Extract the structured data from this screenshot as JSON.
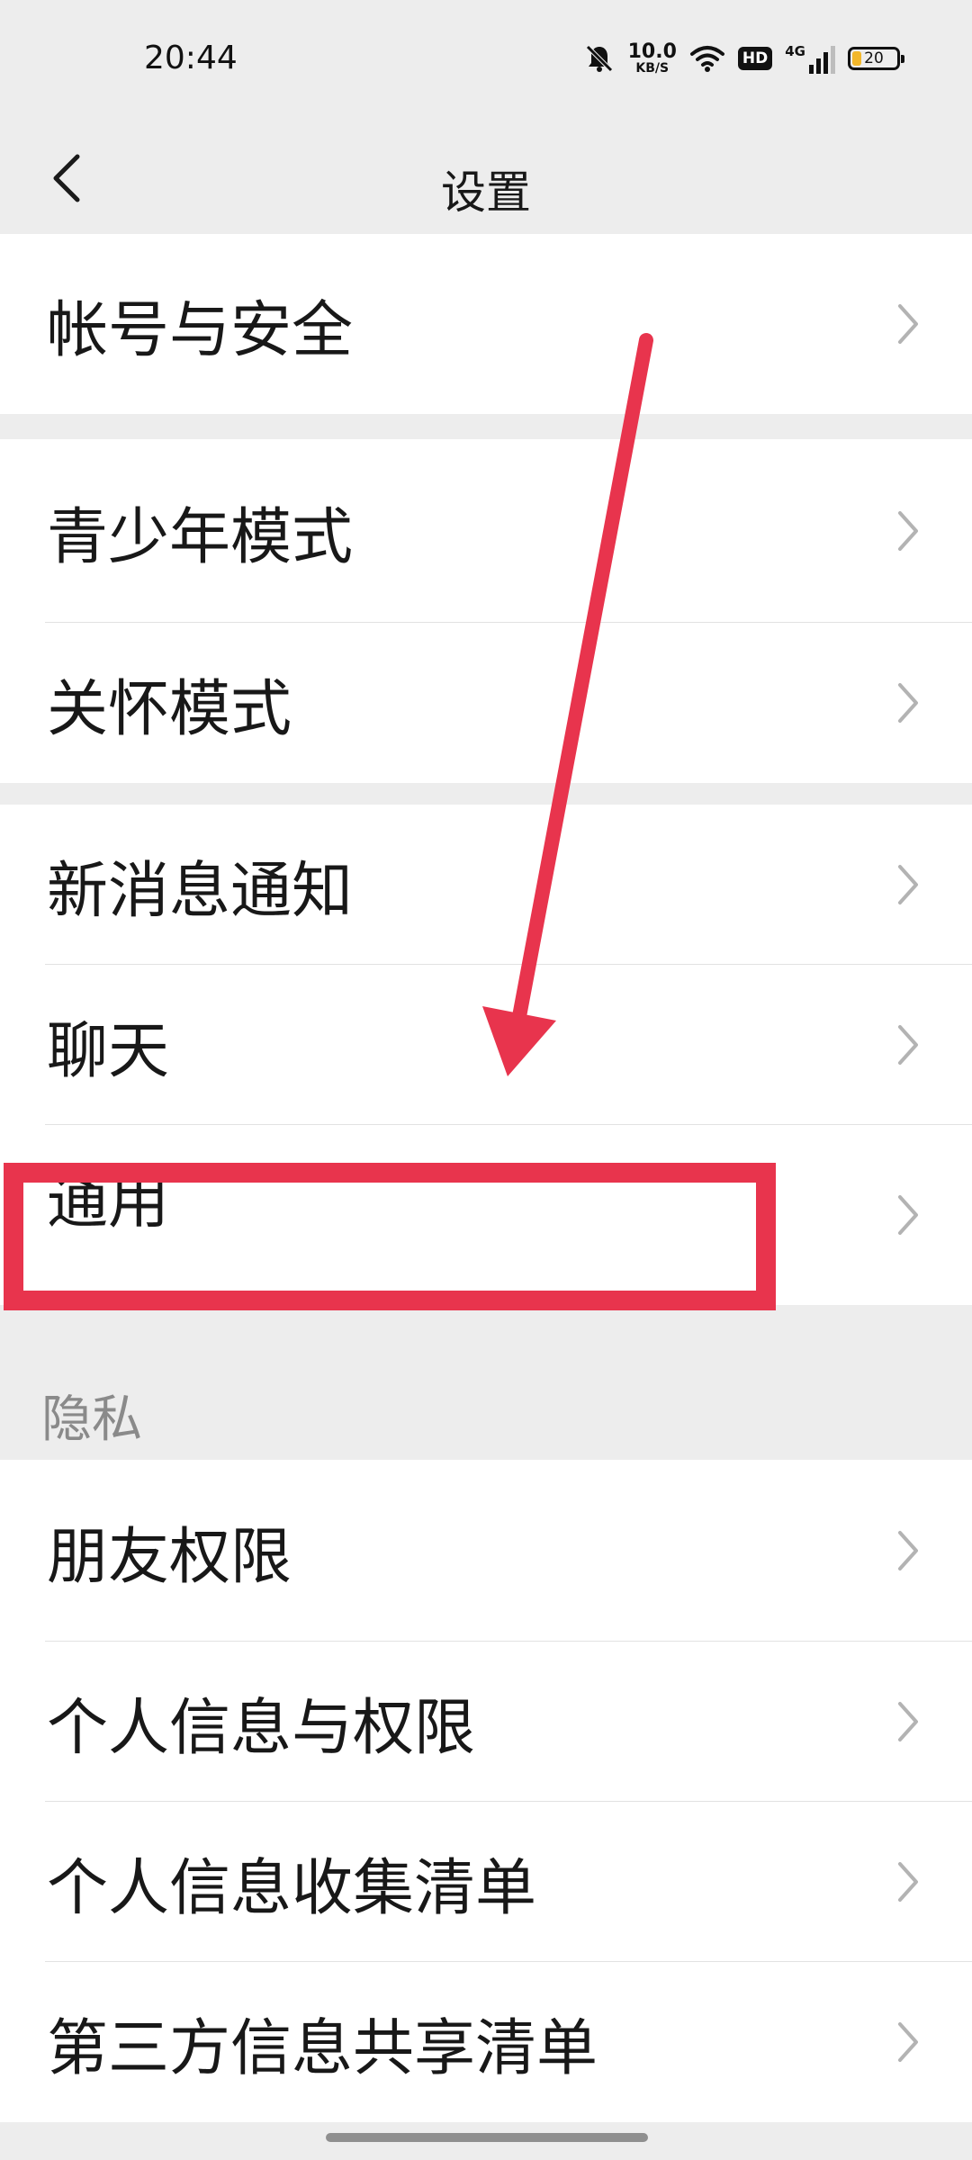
{
  "status_bar": {
    "time": "20:44",
    "net_speed": "10.0",
    "net_unit": "KB/S",
    "hd_badge": "HD",
    "network_type": "4G",
    "battery": "20",
    "icons": [
      "bell-mute-icon",
      "wifi-icon",
      "signal-icon",
      "battery-icon"
    ]
  },
  "nav": {
    "title": "设置",
    "back_icon": "chevron-left-icon"
  },
  "groups": [
    {
      "items": [
        "帐号与安全"
      ]
    },
    {
      "items": [
        "青少年模式",
        "关怀模式"
      ]
    },
    {
      "items": [
        "新消息通知",
        "聊天",
        "通用"
      ]
    },
    {
      "section": "隐私",
      "items": [
        "朋友权限",
        "个人信息与权限",
        "个人信息收集清单",
        "第三方信息共享清单"
      ]
    }
  ],
  "annotations": {
    "highlight_color": "#e8344d",
    "highlighted_item": "通用",
    "arrow_icon": "arrow-down-annotation"
  },
  "colors": {
    "background": "#ededed",
    "surface": "#ffffff",
    "text": "#181818",
    "secondary_text": "#8a8a8a",
    "chevron": "#b3b3b3"
  }
}
